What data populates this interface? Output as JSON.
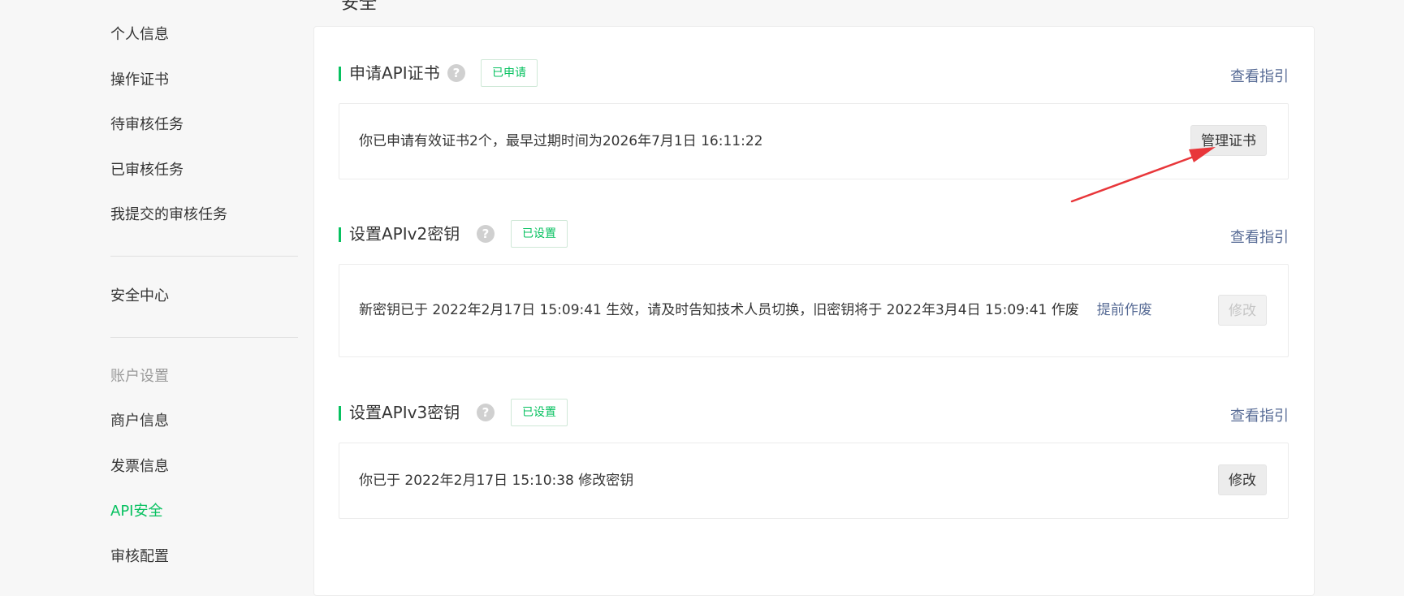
{
  "sidebar": {
    "items_top": [
      "个人信息",
      "操作证书",
      "待审核任务",
      "已审核任务",
      "我提交的审核任务"
    ],
    "security_center": "安全中心",
    "group_title": "账户设置",
    "items_account": [
      "商户信息",
      "发票信息",
      "API安全",
      "审核配置"
    ],
    "active": "API安全"
  },
  "page_title_fragment": "安全",
  "sections": [
    {
      "title": "申请API证书",
      "help_icon": "question-circle-icon",
      "status": "已申请",
      "guide_link": "查看指引",
      "text": "你已申请有效证书2个，最早过期时间为2026年7月1日 16:11:22",
      "button": "管理证书"
    },
    {
      "title": "设置APIv2密钥",
      "help_icon": "question-circle-icon",
      "status": "已设置",
      "guide_link": "查看指引",
      "text": "新密钥已于 2022年2月17日 15:09:41 生效，请及时告知技术人员切换，旧密钥将于 2022年3月4日 15:09:41 作废",
      "inline_link": "提前作废",
      "button": "修改",
      "button_disabled": true
    },
    {
      "title": "设置APIv3密钥",
      "help_icon": "question-circle-icon",
      "status": "已设置",
      "guide_link": "查看指引",
      "text": "你已于 2022年2月17日 15:10:38 修改密钥",
      "button": "修改"
    }
  ],
  "help_glyph": "?",
  "annotation": {
    "icon": "red-arrow-icon",
    "color": "#e8363a"
  },
  "colors": {
    "accent": "#07c160",
    "link": "#576b95"
  }
}
